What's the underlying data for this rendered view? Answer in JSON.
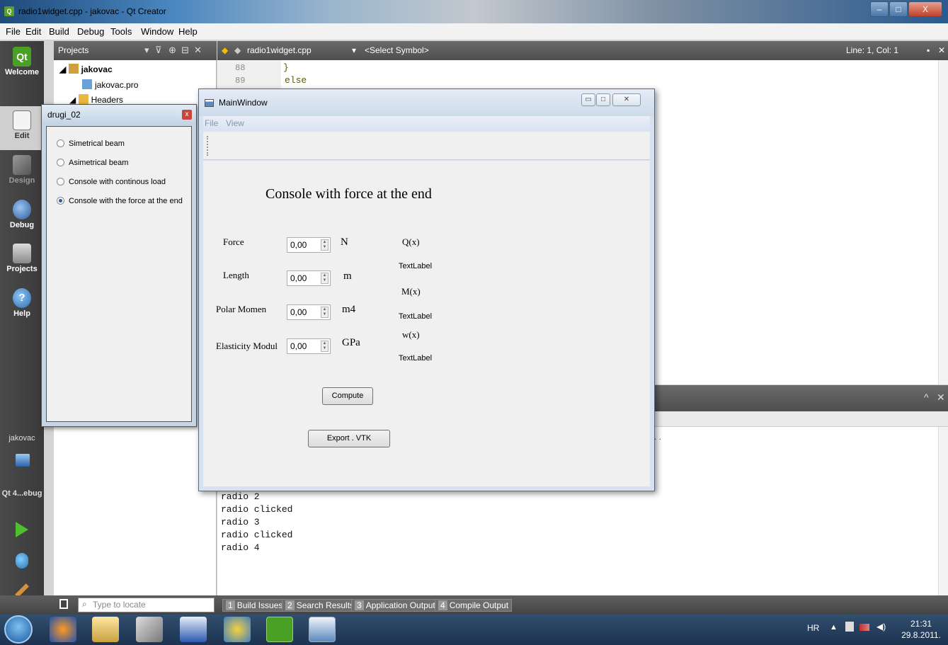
{
  "window": {
    "title": "radio1widget.cpp - jakovac - Qt Creator",
    "min": "–",
    "max": "□",
    "close": "X"
  },
  "menu": [
    "File",
    "Edit",
    "Build",
    "Debug",
    "Tools",
    "Window",
    "Help"
  ],
  "modes": [
    {
      "label": "Welcome",
      "icon": "qt-logo-icon"
    },
    {
      "label": "Edit",
      "icon": "edit-icon"
    },
    {
      "label": "Design",
      "icon": "design-icon"
    },
    {
      "label": "Debug",
      "icon": "debug-icon"
    },
    {
      "label": "Projects",
      "icon": "projects-icon"
    },
    {
      "label": "Help",
      "icon": "help-icon"
    }
  ],
  "sidebar_bottom": {
    "project": "jakovac",
    "kit": "Qt 4...ebug"
  },
  "projects": {
    "header": "Projects",
    "tree": [
      "jakovac",
      "jakovac.pro",
      "Headers"
    ]
  },
  "editor": {
    "file": "radio1widget.cpp",
    "symbol": "<Select Symbol>",
    "position": "Line: 1, Col: 1",
    "lines": [
      {
        "no": "88",
        "text": "}"
      },
      {
        "no": "89",
        "text": "else"
      }
    ]
  },
  "output": {
    "lines": [
      "radio 2",
      "radio clicked",
      "radio 3",
      "radio clicked",
      "radio 4"
    ],
    "ellipsis": ". ."
  },
  "locator": {
    "placeholder": "Type to locate"
  },
  "output_tabs": [
    {
      "n": "1",
      "label": "Build Issues"
    },
    {
      "n": "2",
      "label": "Search Results"
    },
    {
      "n": "3",
      "label": "Application Output"
    },
    {
      "n": "4",
      "label": "Compile Output"
    }
  ],
  "drugi": {
    "title": "drugi_02",
    "options": [
      {
        "label": "Simetrical beam",
        "checked": false
      },
      {
        "label": "Asimetrical beam",
        "checked": false
      },
      {
        "label": "Console with continous load",
        "checked": false
      },
      {
        "label": "Console with the force at the end",
        "checked": true
      }
    ]
  },
  "mainwindow": {
    "title": "MainWindow",
    "menu": [
      "File",
      "View"
    ],
    "heading": "Console with force at the end",
    "inputs": [
      {
        "label": "Force",
        "value": "0,00",
        "unit": "N"
      },
      {
        "label": "Length",
        "value": "0,00",
        "unit": "m"
      },
      {
        "label": "Polar Momen",
        "value": "0,00",
        "unit": "m4"
      },
      {
        "label": "Elasticity Modul",
        "value": "0,00",
        "unit": "GPa"
      }
    ],
    "results": {
      "q_label": "Q(x)",
      "q_value": "TextLabel",
      "m_label": "M(x)",
      "m_value": "TextLabel",
      "w_label": "w(x)",
      "w_value": "TextLabel"
    },
    "compute": "Compute",
    "export": "Export . VTK"
  },
  "tray": {
    "lang": "HR",
    "time": "21:31",
    "date": "29.8.2011."
  }
}
